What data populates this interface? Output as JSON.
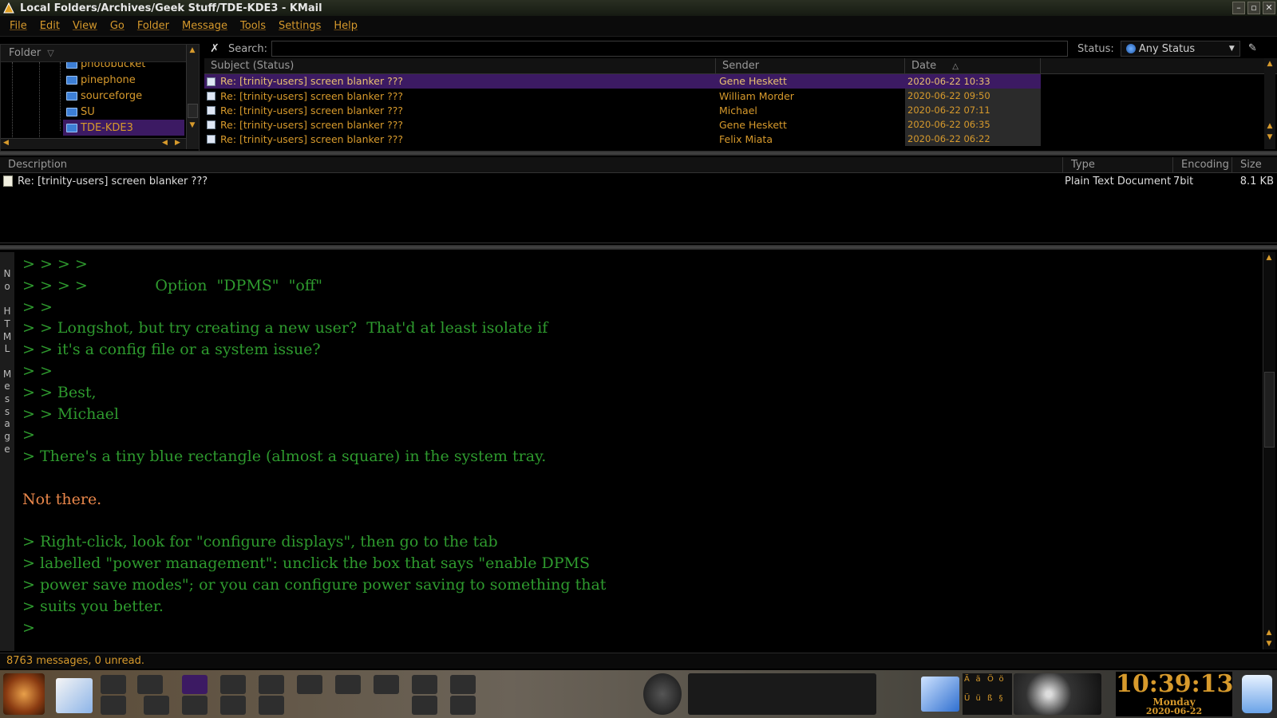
{
  "window": {
    "title": "Local Folders/Archives/Geek Stuff/TDE-KDE3 - KMail"
  },
  "menu": [
    "File",
    "Edit",
    "View",
    "Go",
    "Folder",
    "Message",
    "Tools",
    "Settings",
    "Help"
  ],
  "folders": {
    "header": "Folder",
    "items": [
      {
        "label": "photobucket",
        "selected": false
      },
      {
        "label": "pinephone",
        "selected": false
      },
      {
        "label": "sourceforge",
        "selected": false
      },
      {
        "label": "SU",
        "selected": false
      },
      {
        "label": "TDE-KDE3",
        "selected": true
      }
    ]
  },
  "search": {
    "label": "Search:",
    "value": "",
    "status_label": "Status:",
    "status_value": "Any Status"
  },
  "message_list": {
    "columns": {
      "subject": "Subject (Status)",
      "sender": "Sender",
      "date": "Date"
    },
    "rows": [
      {
        "subject": "Re: [trinity-users] screen blanker ???",
        "sender": "Gene Heskett",
        "date": "2020-06-22 10:33",
        "selected": true
      },
      {
        "subject": "Re: [trinity-users] screen blanker ???",
        "sender": "William Morder",
        "date": "2020-06-22 09:50",
        "selected": false
      },
      {
        "subject": "Re: [trinity-users] screen blanker ???",
        "sender": "Michael",
        "date": "2020-06-22 07:11",
        "selected": false
      },
      {
        "subject": "Re: [trinity-users] screen blanker ???",
        "sender": "Gene Heskett",
        "date": "2020-06-22 06:35",
        "selected": false
      },
      {
        "subject": "Re: [trinity-users] screen blanker ???",
        "sender": "Felix Miata",
        "date": "2020-06-22 06:22",
        "selected": false
      }
    ]
  },
  "attachments": {
    "columns": {
      "description": "Description",
      "type": "Type",
      "encoding": "Encoding",
      "size": "Size"
    },
    "rows": [
      {
        "description": "Re: [trinity-users] screen blanker ???",
        "type": "Plain Text Document",
        "encoding": "7bit",
        "size": "8.1 KB"
      }
    ]
  },
  "reader": {
    "side_label": "No HTML Message",
    "lines": [
      {
        "text": "> > > >",
        "quoted": true
      },
      {
        "text": "> > > >              Option  \"DPMS\"  \"off\"",
        "quoted": true
      },
      {
        "text": "> >",
        "quoted": true
      },
      {
        "text": "> > Longshot, but try creating a new user?  That'd at least isolate if",
        "quoted": true
      },
      {
        "text": "> > it's a config file or a system issue?",
        "quoted": true
      },
      {
        "text": "> >",
        "quoted": true
      },
      {
        "text": "> > Best,",
        "quoted": true
      },
      {
        "text": "> > Michael",
        "quoted": true
      },
      {
        "text": ">",
        "quoted": true
      },
      {
        "text": "> There's a tiny blue rectangle (almost a square) in the system tray.",
        "quoted": true
      },
      {
        "text": "",
        "quoted": true
      },
      {
        "text": "Not there.",
        "quoted": false
      },
      {
        "text": "",
        "quoted": true
      },
      {
        "text": "> Right-click, look for \"configure displays\", then go to the tab",
        "quoted": true
      },
      {
        "text": "> labelled \"power management\": unclick the box that says \"enable DPMS",
        "quoted": true
      },
      {
        "text": "> power save modes\"; or you can configure power saving to something that",
        "quoted": true
      },
      {
        "text": "> suits you better.",
        "quoted": true
      },
      {
        "text": ">",
        "quoted": true
      }
    ]
  },
  "statusbar": {
    "text": "8763 messages, 0 unread."
  },
  "clock": {
    "time": "10:39:13",
    "day": "Monday",
    "date": "2020-06-22"
  },
  "tray": {
    "keyboard_glyphs": [
      "Ä",
      "ä",
      "Ö",
      "ö",
      "Ü",
      "ü",
      "ß",
      "§"
    ]
  },
  "colors": {
    "accent": "#d79a2c",
    "selection": "#3c1a63",
    "quote": "#2e9a2e",
    "plain_text": "#e8864a"
  }
}
